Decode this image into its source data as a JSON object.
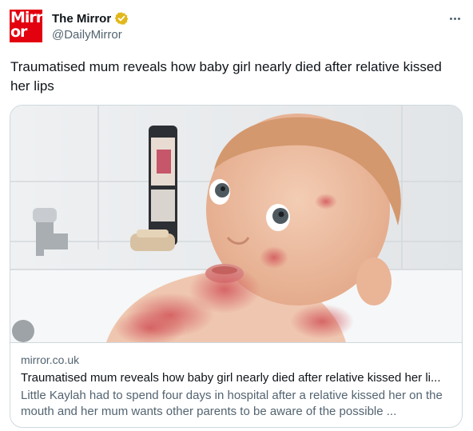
{
  "account": {
    "display_name": "The Mirror",
    "handle": "@DailyMirror",
    "verified_badge": "verified-gold-badge",
    "logo_line1": "Mirr",
    "logo_line2": "or",
    "logo_color": "#e3000f"
  },
  "more_menu": "more-options-icon",
  "tweet": {
    "text": "Traumatised mum reveals how baby girl nearly died after relative kissed her lips"
  },
  "card": {
    "domain": "mirror.co.uk",
    "title": "Traumatised mum reveals how baby girl nearly died after relative kissed her li...",
    "description": "Little Kaylah had to spend four days in hospital after a relative kissed her on the mouth and her mum wants other parents to be aware of the possible ..."
  },
  "colors": {
    "text": "#0f1419",
    "secondary": "#536471",
    "border": "#cfd9de",
    "badge": "#e2b719"
  }
}
